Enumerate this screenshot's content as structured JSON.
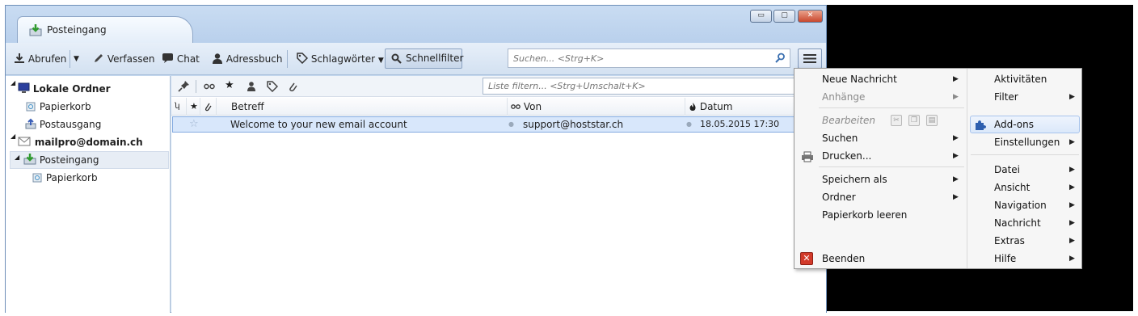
{
  "window": {
    "tab_title": "Posteingang",
    "controls": {
      "minimize": "▭",
      "maximize": "▢",
      "close": "✕"
    }
  },
  "toolbar": {
    "get_mail": "Abrufen",
    "write": "Verfassen",
    "chat": "Chat",
    "address_book": "Adressbuch",
    "tags": "Schlagwörter",
    "quick_filter": "Schnellfilter",
    "search_placeholder": "Suchen... <Strg+K>"
  },
  "folders": [
    {
      "label": "Lokale Ordner",
      "bold": true
    },
    {
      "label": "Papierkorb"
    },
    {
      "label": "Postausgang"
    },
    {
      "label": "mailpro@domain.ch",
      "bold": true
    },
    {
      "label": "Posteingang",
      "selected": true
    },
    {
      "label": "Papierkorb"
    }
  ],
  "filterbar": {
    "placeholder": "Liste filtern... <Strg+Umschalt+K>"
  },
  "columns": {
    "subject": "Betreff",
    "from": "Von",
    "date": "Datum"
  },
  "messages": [
    {
      "subject": "Welcome to your new email account",
      "from": "support@hoststar.ch",
      "date": "18.05.2015 17:30"
    }
  ],
  "menu": {
    "left": [
      {
        "label": "Neue Nachricht",
        "submenu": true
      },
      {
        "label": "Anhänge",
        "submenu": true,
        "disabled": true
      },
      {
        "label": "Bearbeiten",
        "disabled": true
      },
      {
        "label": "Suchen",
        "submenu": true
      },
      {
        "label": "Drucken...",
        "submenu": true
      },
      {
        "label": "Speichern als",
        "submenu": true
      },
      {
        "label": "Ordner",
        "submenu": true
      },
      {
        "label": "Papierkorb leeren"
      },
      {
        "label": "Beenden"
      }
    ],
    "right": [
      {
        "label": "Aktivitäten"
      },
      {
        "label": "Filter",
        "submenu": true
      },
      {
        "label": "Add-ons",
        "highlighted": true
      },
      {
        "label": "Einstellungen",
        "submenu": true
      },
      {
        "label": "Datei",
        "submenu": true
      },
      {
        "label": "Ansicht",
        "submenu": true
      },
      {
        "label": "Navigation",
        "submenu": true
      },
      {
        "label": "Nachricht",
        "submenu": true
      },
      {
        "label": "Extras",
        "submenu": true
      },
      {
        "label": "Hilfe",
        "submenu": true
      }
    ],
    "arrow_glyph": "▶"
  },
  "colors": {
    "accent": "#3a78d4",
    "selection": "#d8e7fb",
    "black_panel": "#000000",
    "close_red": "#c9472d"
  }
}
